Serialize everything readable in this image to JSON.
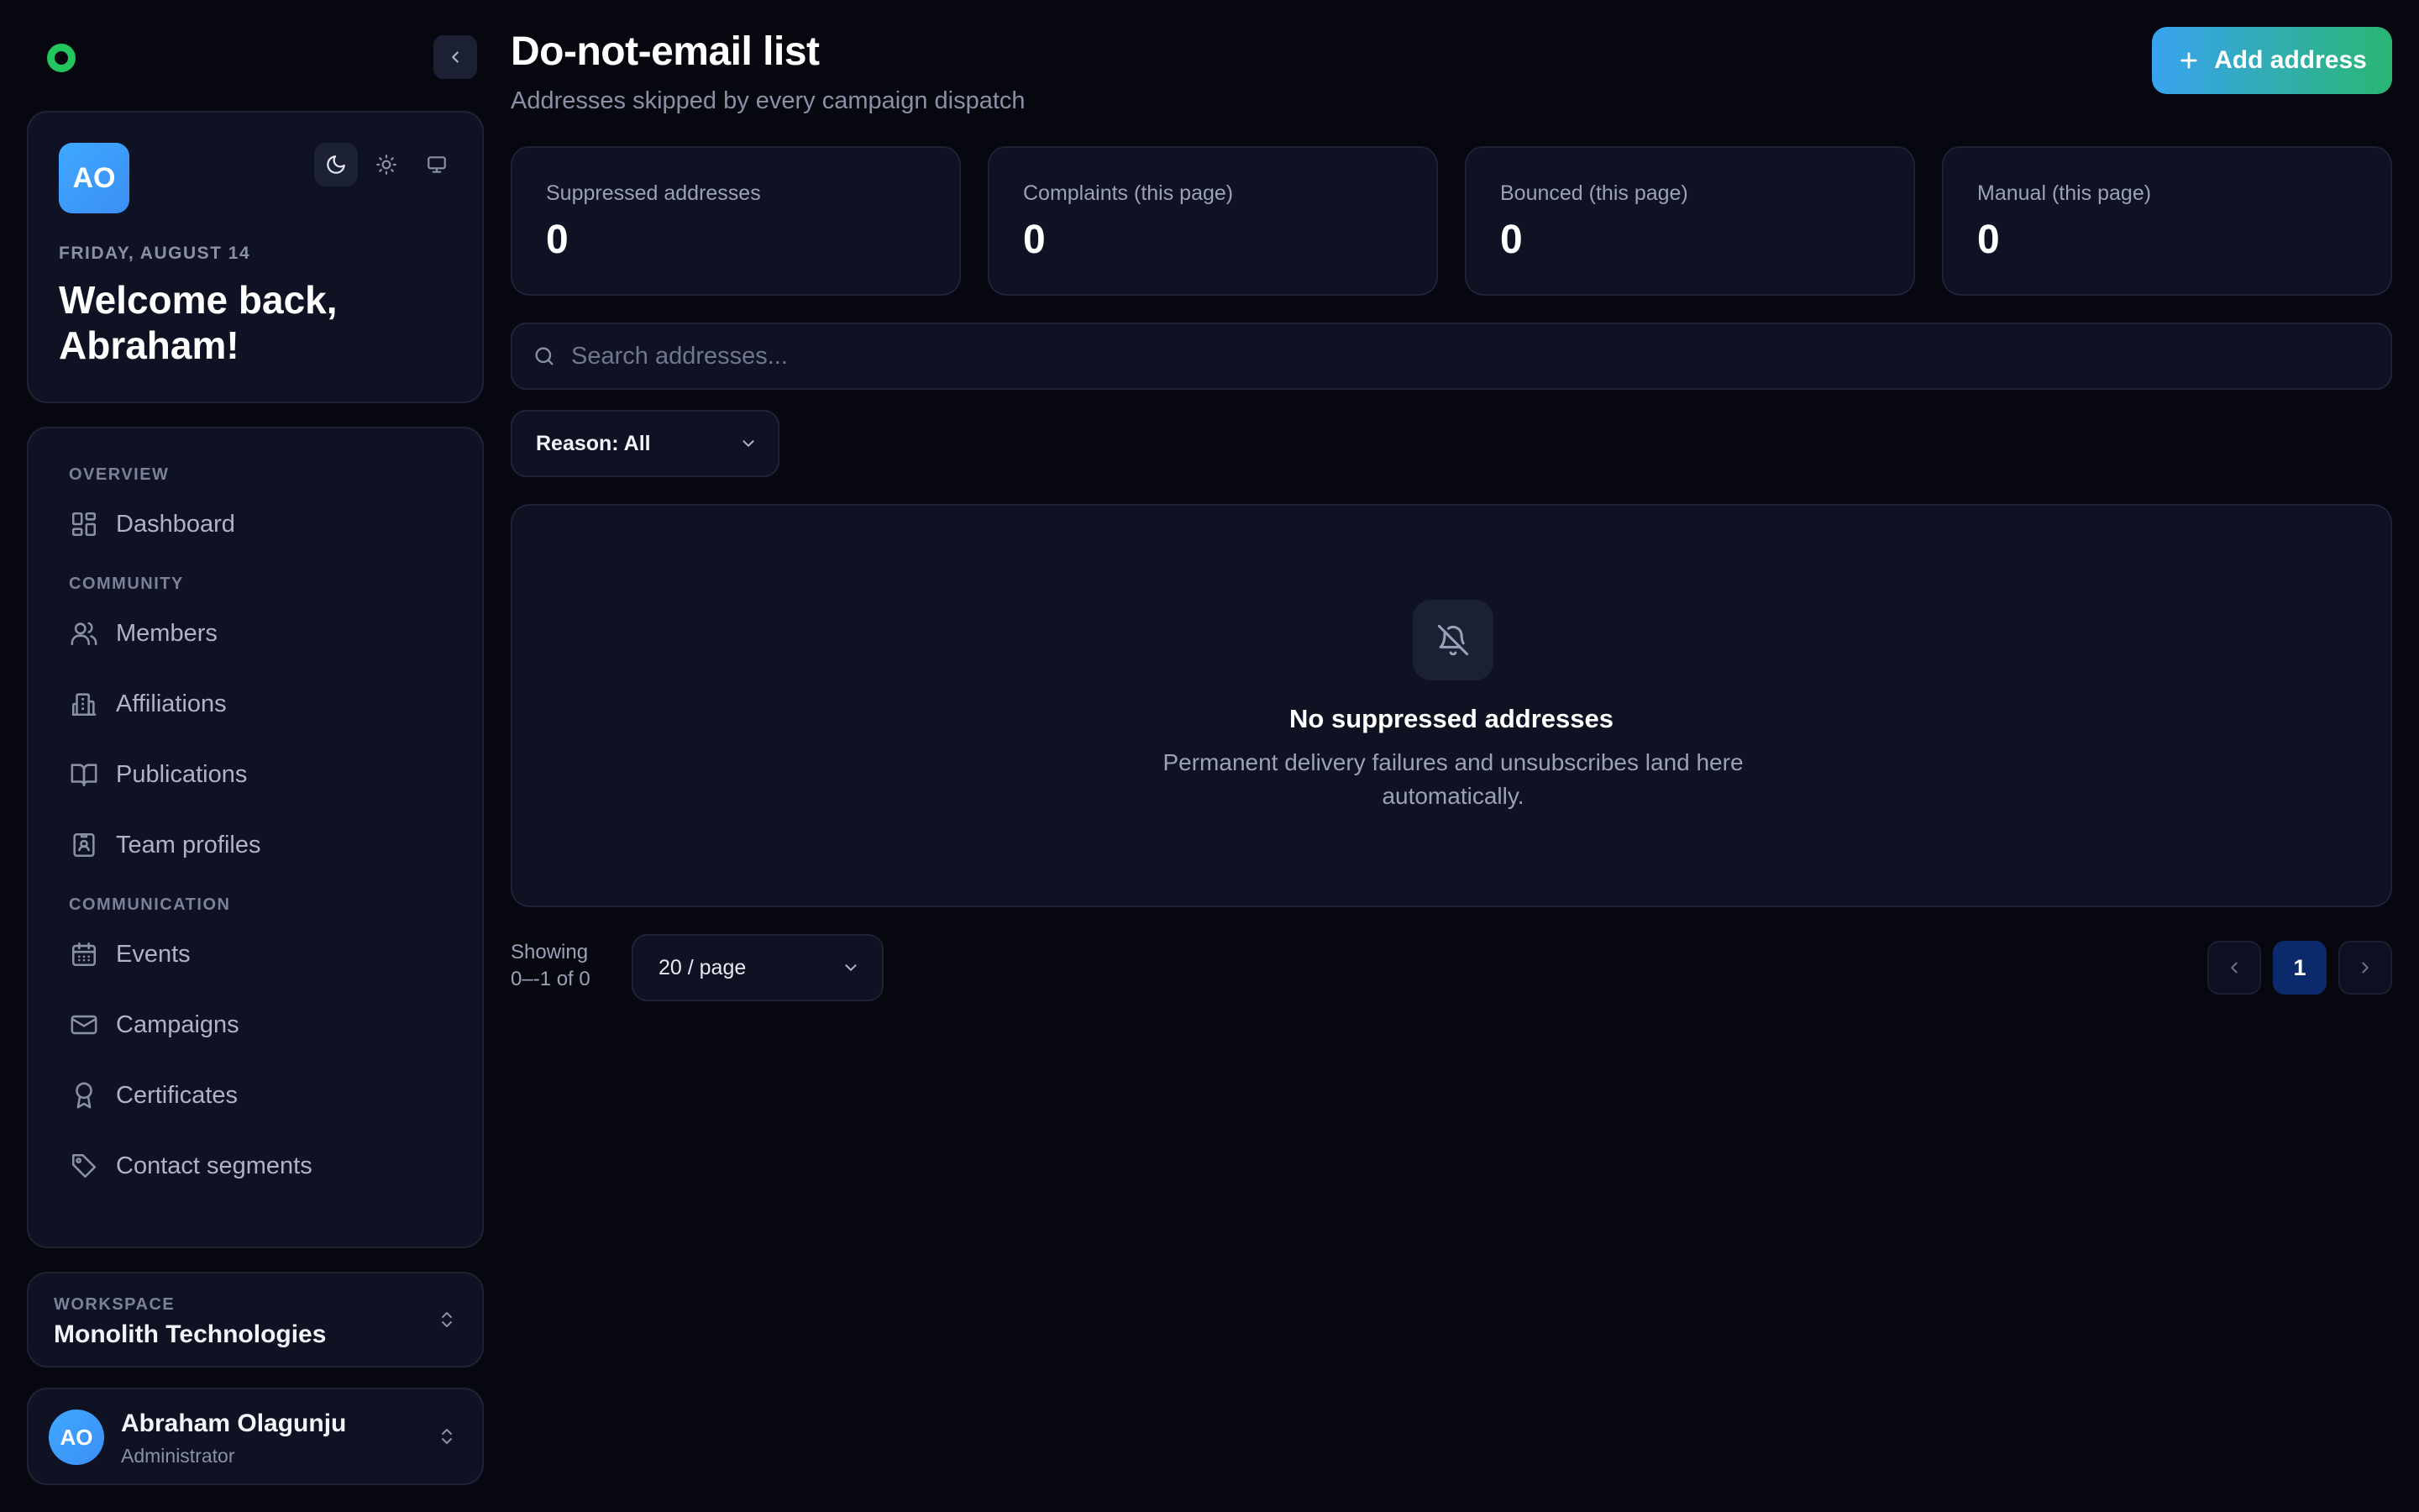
{
  "theme": {
    "accent": "#22c55e",
    "brand_gradient": [
      "#38a3f0",
      "#2bb673"
    ],
    "avatar": "#3b8ef5",
    "current_page_bg": "#0b2a6b"
  },
  "sidebar": {
    "welcome": {
      "initials": "AO",
      "date": "FRIDAY, AUGUST 14",
      "greeting": "Welcome back, Abraham!",
      "theme_options": [
        "moon-icon",
        "sun-icon",
        "monitor-icon"
      ],
      "active_theme": "moon-icon"
    },
    "sections": [
      {
        "label": "OVERVIEW",
        "items": [
          {
            "label": "Dashboard",
            "icon": "dashboard-icon"
          }
        ]
      },
      {
        "label": "COMMUNITY",
        "items": [
          {
            "label": "Members",
            "icon": "users-icon"
          },
          {
            "label": "Affiliations",
            "icon": "building-icon"
          },
          {
            "label": "Publications",
            "icon": "book-icon"
          },
          {
            "label": "Team profiles",
            "icon": "id-badge-icon"
          }
        ]
      },
      {
        "label": "COMMUNICATION",
        "items": [
          {
            "label": "Events",
            "icon": "calendar-icon"
          },
          {
            "label": "Campaigns",
            "icon": "mail-icon"
          },
          {
            "label": "Certificates",
            "icon": "award-icon"
          },
          {
            "label": "Contact segments",
            "icon": "tag-icon"
          }
        ]
      }
    ],
    "workspace": {
      "label": "WORKSPACE",
      "name": "Monolith Technologies"
    },
    "user": {
      "initials": "AO",
      "name": "Abraham Olagunju",
      "role": "Administrator"
    }
  },
  "header": {
    "title": "Do-not-email list",
    "subtitle": "Addresses skipped by every campaign dispatch",
    "add_button": "Add address"
  },
  "stats": [
    {
      "label": "Suppressed addresses",
      "value": "0"
    },
    {
      "label": "Complaints (this page)",
      "value": "0"
    },
    {
      "label": "Bounced (this page)",
      "value": "0"
    },
    {
      "label": "Manual (this page)",
      "value": "0"
    }
  ],
  "search": {
    "placeholder": "Search addresses...",
    "value": ""
  },
  "filter": {
    "reason": "Reason: All"
  },
  "empty_state": {
    "title": "No suppressed addresses",
    "description": "Permanent delivery failures and unsubscribes land here automatically."
  },
  "pagination": {
    "showing_label": "Showing",
    "showing_range": "0–-1 of 0",
    "per_page": "20 / page",
    "current_page": "1"
  }
}
